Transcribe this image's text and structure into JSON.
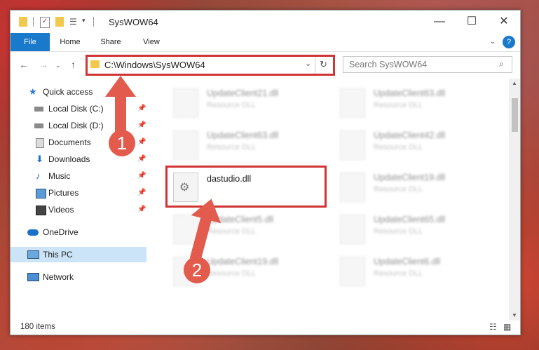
{
  "window": {
    "title": "SysWOW64"
  },
  "ribbon": {
    "tabs": [
      "File",
      "Home",
      "Share",
      "View"
    ]
  },
  "address": {
    "path": "C:\\Windows\\SysWOW64"
  },
  "search": {
    "placeholder": "Search SysWOW64"
  },
  "sidebar": {
    "items": [
      {
        "label": "Quick access",
        "icon": "star-icon"
      },
      {
        "label": "Local Disk (C:)",
        "icon": "drive-icon"
      },
      {
        "label": "Local Disk (D:)",
        "icon": "drive-icon"
      },
      {
        "label": "Documents",
        "icon": "documents-icon"
      },
      {
        "label": "Downloads",
        "icon": "downloads-icon"
      },
      {
        "label": "Music",
        "icon": "music-icon"
      },
      {
        "label": "Pictures",
        "icon": "pictures-icon"
      },
      {
        "label": "Videos",
        "icon": "videos-icon"
      },
      {
        "label": "OneDrive",
        "icon": "cloud-icon"
      },
      {
        "label": "This PC",
        "icon": "computer-icon"
      },
      {
        "label": "Network",
        "icon": "network-icon"
      }
    ]
  },
  "files": [
    {
      "name": "UpdateClient21.dll",
      "type": "Resource DLL"
    },
    {
      "name": "UpdateClient63.dll",
      "type": "Resource DLL"
    },
    {
      "name": "UpdateClient63.dll",
      "type": "Resource DLL"
    },
    {
      "name": "UpdateClient42.dll",
      "type": "Resource DLL"
    },
    {
      "name": "dastudio.dll",
      "type": ""
    },
    {
      "name": "UpdateClient19.dll",
      "type": "Resource DLL"
    },
    {
      "name": "UpdateClient5.dll",
      "type": "Resource DLL"
    },
    {
      "name": "UpdateClient65.dll",
      "type": "Resource DLL"
    },
    {
      "name": "UpdateClient19.dll",
      "type": "Resource DLL"
    },
    {
      "name": "UpdateClient6.dll",
      "type": "Resource DLL"
    }
  ],
  "status": {
    "items_count": "180 items"
  },
  "annotations": {
    "step1": "1",
    "step2": "2"
  }
}
